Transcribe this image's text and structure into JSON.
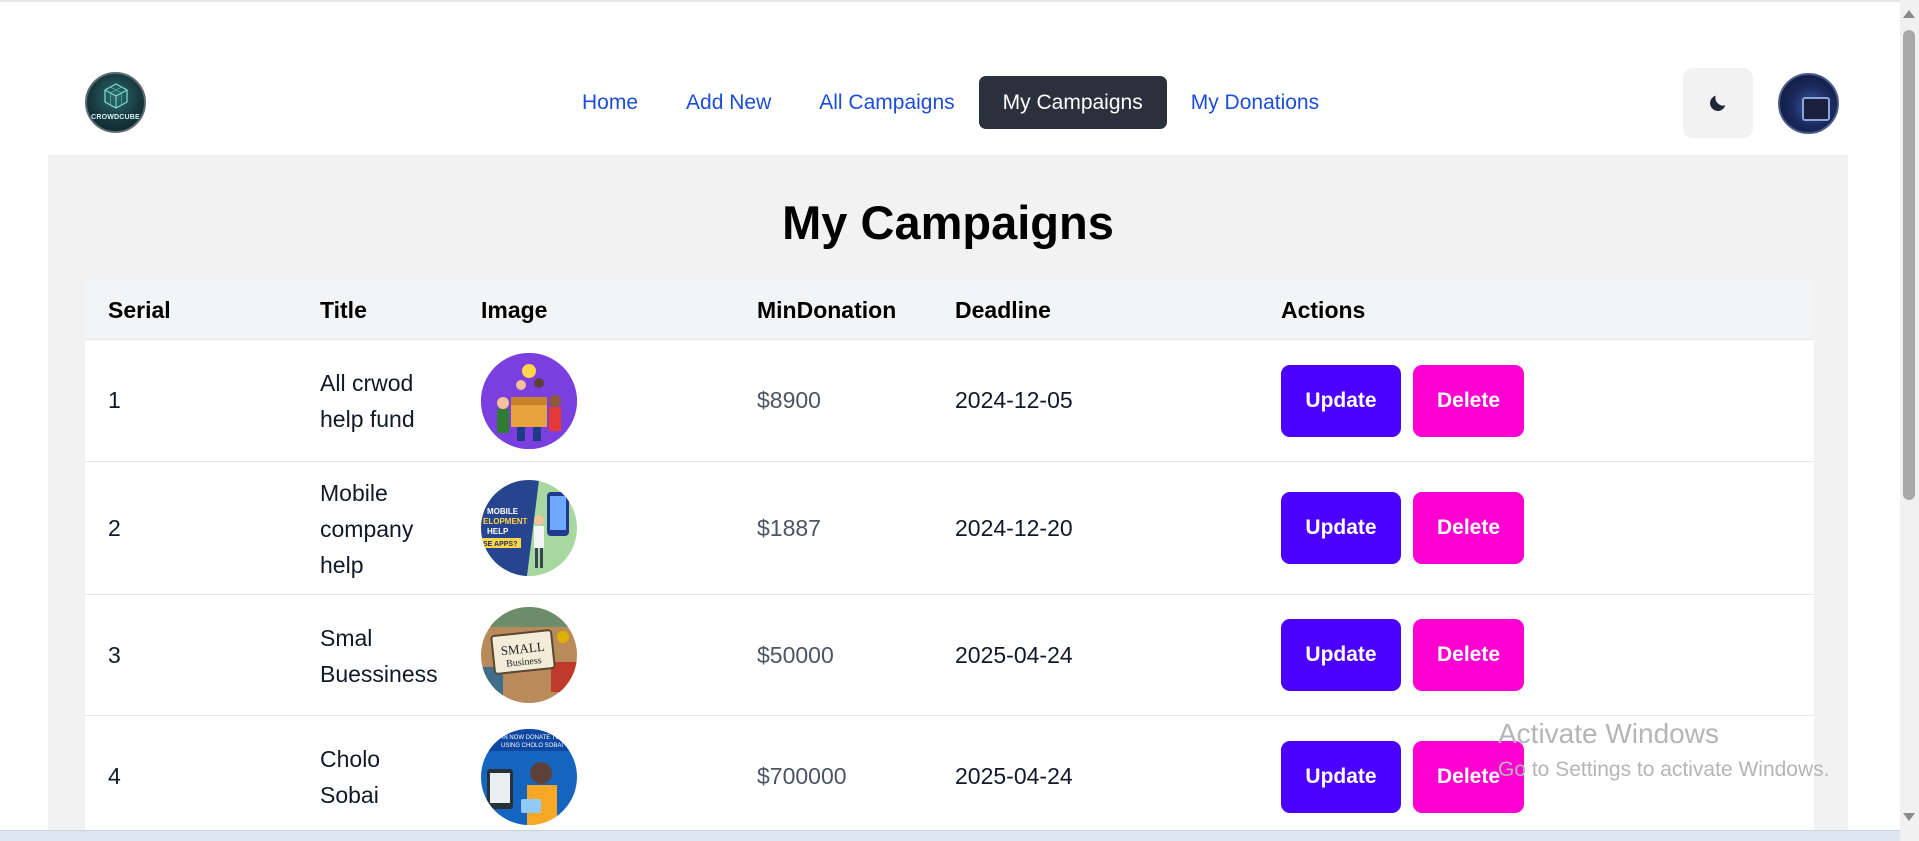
{
  "nav": {
    "logo_text": "CROWDCUBE",
    "links": [
      {
        "label": "Home",
        "active": false
      },
      {
        "label": "Add New",
        "active": false
      },
      {
        "label": "All Campaigns",
        "active": false
      },
      {
        "label": "My Campaigns",
        "active": true
      },
      {
        "label": "My Donations",
        "active": false
      }
    ],
    "theme_icon": "moon-icon"
  },
  "page": {
    "title": "My Campaigns"
  },
  "table": {
    "headers": [
      "Serial",
      "Title",
      "Image",
      "MinDonation",
      "Deadline",
      "Actions"
    ],
    "rows": [
      {
        "serial": "1",
        "title": "All crwod help fund",
        "title_lines": [
          "All crwod",
          "help fund"
        ],
        "image": "crowd-fund-image",
        "min_donation": "$8900",
        "deadline": "2024-12-05",
        "update": "Update",
        "delete": "Delete"
      },
      {
        "serial": "2",
        "title": "Mobile company help",
        "title_lines": [
          "Mobile",
          "company",
          "help"
        ],
        "image": "mobile-development-image",
        "min_donation": "$1887",
        "deadline": "2024-12-20",
        "update": "Update",
        "delete": "Delete"
      },
      {
        "serial": "3",
        "title": "Smal Buessiness",
        "title_lines": [
          "Smal",
          "Buessiness"
        ],
        "image": "small-business-image",
        "min_donation": "$50000",
        "deadline": "2025-04-24",
        "update": "Update",
        "delete": "Delete"
      },
      {
        "serial": "4",
        "title": "Cholo Sobai",
        "title_lines": [
          "Cholo",
          "Sobai"
        ],
        "image": "donate-app-image",
        "min_donation": "$700000",
        "deadline": "2025-04-24",
        "update": "Update",
        "delete": "Delete"
      }
    ]
  },
  "thumb_text": {
    "mobile": [
      "MOBILE",
      "ELOPMENT",
      "HELP",
      "SE APPS?"
    ],
    "small_business": [
      "SMALL",
      "Business"
    ],
    "donate": [
      "HAN NOW DONATE TO",
      "USING CHOLO SOBAI"
    ]
  },
  "watermark": {
    "line1": "Activate Windows",
    "line2": "Go to Settings to activate Windows."
  },
  "colors": {
    "nav_link": "#1d4ed8",
    "nav_active_bg": "#2a303c",
    "update_button": "#4c00ff",
    "delete_button": "#ff00d0",
    "panel_bg": "#f2f2f2"
  }
}
